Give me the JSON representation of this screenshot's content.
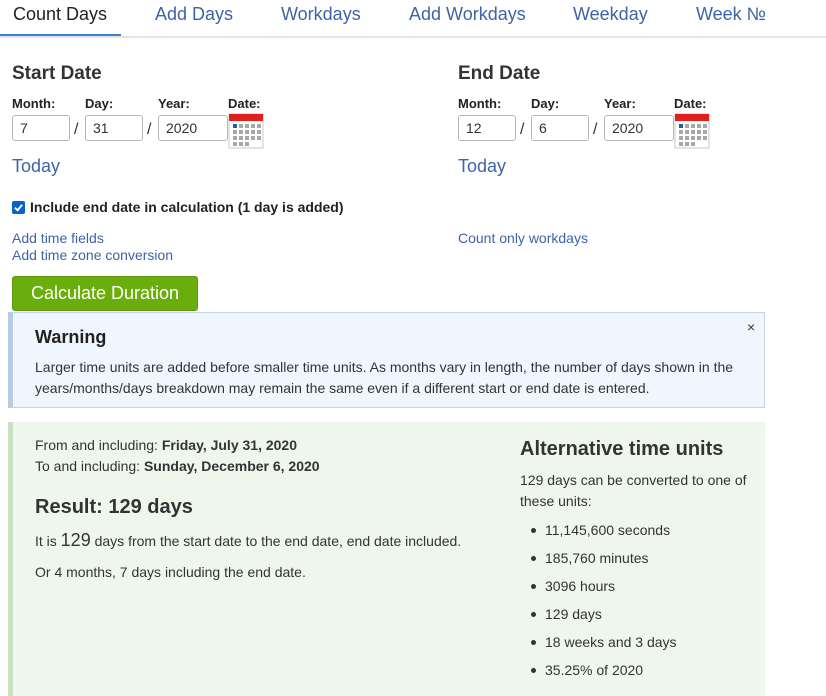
{
  "tabs": [
    {
      "label": "Count Days",
      "active": true
    },
    {
      "label": "Add Days",
      "active": false
    },
    {
      "label": "Workdays",
      "active": false
    },
    {
      "label": "Add Workdays",
      "active": false
    },
    {
      "label": "Weekday",
      "active": false
    },
    {
      "label": "Week №",
      "active": false
    }
  ],
  "start": {
    "title": "Start Date",
    "month_label": "Month:",
    "day_label": "Day:",
    "year_label": "Year:",
    "date_label": "Date:",
    "month": "7",
    "day": "31",
    "year": "2020",
    "today": "Today"
  },
  "end": {
    "title": "End Date",
    "month_label": "Month:",
    "day_label": "Day:",
    "year_label": "Year:",
    "date_label": "Date:",
    "month": "12",
    "day": "6",
    "year": "2020",
    "today": "Today"
  },
  "separator": "/",
  "options": {
    "include_end_label": "Include end date in calculation (1 day is added)",
    "include_end_checked": true,
    "add_time_fields": "Add time fields",
    "add_timezone": "Add time zone conversion",
    "count_workdays": "Count only workdays"
  },
  "calculate_label": "Calculate Duration",
  "warning": {
    "title": "Warning",
    "text": "Larger time units are added before smaller time units. As months vary in length, the number of days shown in the years/months/days breakdown may remain the same even if a different start or end date is entered.",
    "close": "×"
  },
  "result": {
    "from_prefix": "From and including: ",
    "from_value": "Friday, July 31, 2020",
    "to_prefix": "To and including: ",
    "to_value": "Sunday, December 6, 2020",
    "title": "Result: 129 days",
    "line1_prefix": "It is ",
    "line1_number": "129",
    "line1_suffix": " days from the start date to the end date, end date included.",
    "line2": "Or 4 months, 7 days including the end date."
  },
  "alternative": {
    "title": "Alternative time units",
    "description": "129 days can be converted to one of these units:",
    "items": [
      "11,145,600 seconds",
      "185,760 minutes",
      "3096 hours",
      "129 days",
      "18 weeks and 3 days",
      "35.25% of 2020"
    ]
  },
  "colors": {
    "link": "#3f63a8",
    "button": "#6aae0d",
    "result_bg": "#eff7ec",
    "warning_bg": "#f0f6fd"
  },
  "icons": [
    "calendar-icon",
    "checkmark-icon",
    "close-icon"
  ]
}
